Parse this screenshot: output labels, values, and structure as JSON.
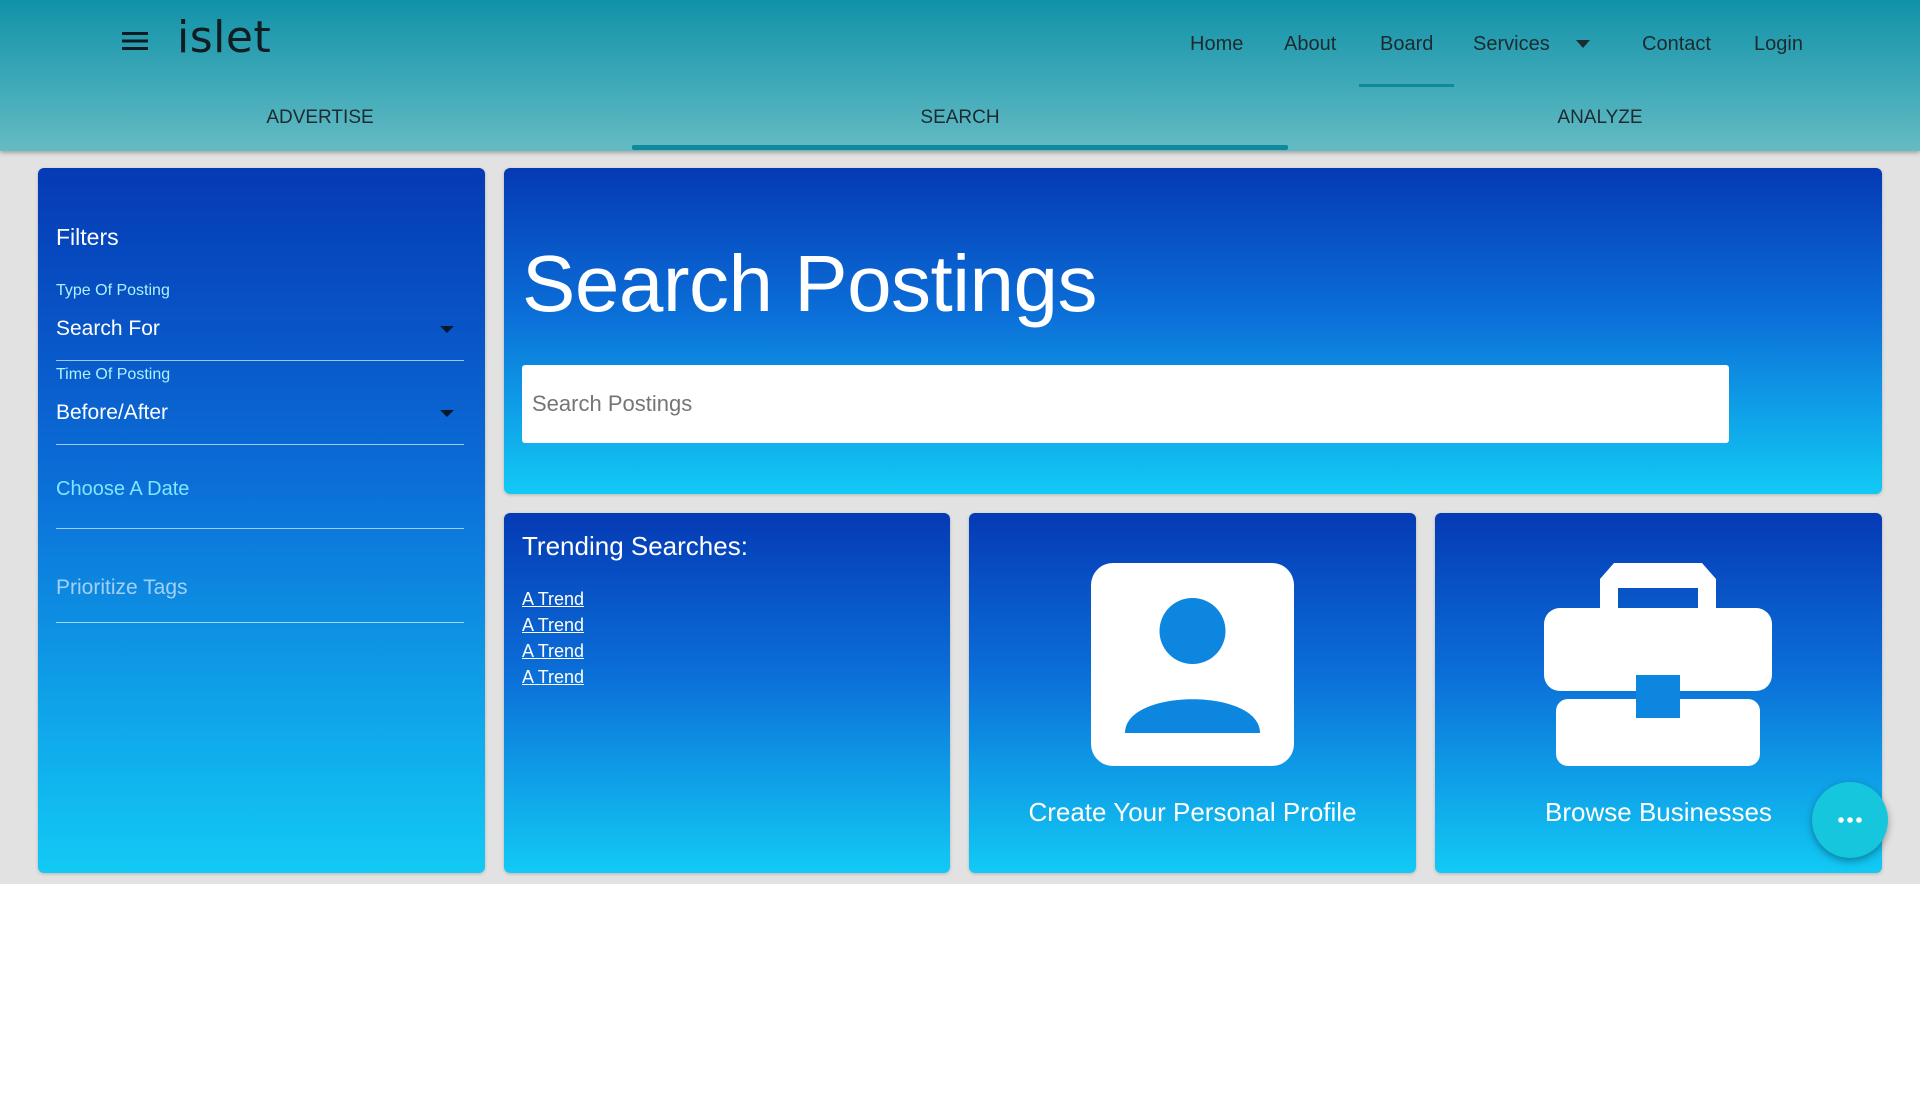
{
  "header": {
    "brand": "islet",
    "nav": [
      {
        "label": "Home"
      },
      {
        "label": "About"
      },
      {
        "label": "Board"
      },
      {
        "label": "Services"
      },
      {
        "label": "Contact"
      },
      {
        "label": "Login"
      }
    ],
    "active_nav": "Board"
  },
  "tabs": [
    {
      "label": "ADVERTISE"
    },
    {
      "label": "SEARCH"
    },
    {
      "label": "ANALYZE"
    }
  ],
  "active_tab": "SEARCH",
  "filters": {
    "title": "Filters",
    "type_label": "Type Of Posting",
    "type_value": "Search For",
    "time_label": "Time Of Posting",
    "time_value": "Before/After",
    "date_placeholder": "Choose A Date",
    "tags_placeholder": "Prioritize Tags"
  },
  "hero": {
    "title": "Search Postings",
    "search_placeholder": "Search Postings"
  },
  "trending": {
    "title": "Trending Searches:",
    "links": [
      "A Trend",
      "A Trend",
      "A Trend",
      "A Trend"
    ]
  },
  "profile_card": {
    "label": "Create Your Personal Profile",
    "icon": "account-box-icon"
  },
  "business_card": {
    "label": "Browse Businesses",
    "icon": "briefcase-icon"
  },
  "fab": {
    "icon": "more-horizontal-icon"
  },
  "colors": {
    "appbar": "#1192a9",
    "card_top": "#053ab4",
    "card_bottom": "#12caf5",
    "accent": "#0e8a9c",
    "fab": "#16c6dd"
  }
}
